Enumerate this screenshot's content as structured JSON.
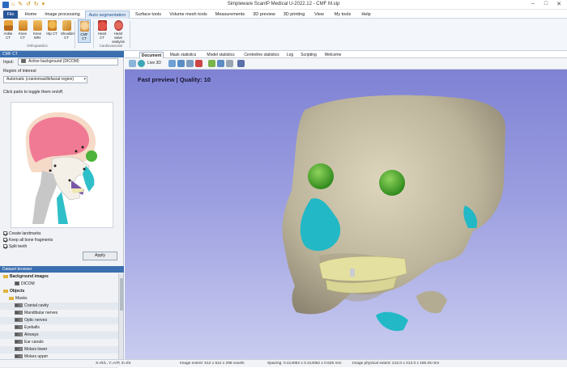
{
  "window": {
    "title": "Simpleware ScanIP Medical U-2022.12 - CMF M.sip",
    "quick_access": "⌂ ✎ ↺ ↻ ▾"
  },
  "menu": [
    "File",
    "Home",
    "Image processing",
    "Auto segmentation",
    "Surface tools",
    "Volume mesh tools",
    "Measurements",
    "3D preview",
    "3D printing",
    "View",
    "My tools",
    "Help"
  ],
  "ribbon": {
    "orthopaedics": {
      "buttons": [
        "Ankle CT",
        "Knee CT",
        "Knee MRI",
        "Hip CT",
        "Shoulder CT"
      ],
      "label": "Orthopaedics"
    },
    "cmf": {
      "buttons": [
        "CMF CT"
      ]
    },
    "cardiovascular": {
      "buttons": [
        "Heart CT",
        "Heart valve analysis"
      ],
      "label": "Cardiovascular"
    }
  },
  "left_panel": {
    "header": "CMF CT",
    "input_label": "Input:",
    "input_value": "Active background (DICOM)",
    "roi_label": "Region of interest",
    "roi_value": "Automatic (craniomaxillofacial region)",
    "toggle_hint": "Click parts to toggle them on/off.",
    "checkboxes": [
      "Create landmarks",
      "Keep all bone fragments",
      "Split teeth"
    ],
    "apply": "Apply"
  },
  "dataset_browser": {
    "header": "Dataset browser",
    "rows": [
      {
        "label": "Background images",
        "indent": 0,
        "kind": "folder"
      },
      {
        "label": "DICOM",
        "indent": 2,
        "kind": "dicom"
      },
      {
        "label": "Objects",
        "indent": 0,
        "kind": "folder"
      },
      {
        "label": "Masks",
        "indent": 1,
        "kind": "folder"
      },
      {
        "label": "Cranial cavity",
        "indent": 2,
        "kind": "mask"
      },
      {
        "label": "Mandibular nerves",
        "indent": 2,
        "kind": "mask"
      },
      {
        "label": "Optic nerves",
        "indent": 2,
        "kind": "mask"
      },
      {
        "label": "Eyeballs",
        "indent": 2,
        "kind": "mask"
      },
      {
        "label": "Airways",
        "indent": 2,
        "kind": "mask"
      },
      {
        "label": "Ear canals",
        "indent": 2,
        "kind": "mask"
      },
      {
        "label": "Molars lower",
        "indent": 2,
        "kind": "mask"
      },
      {
        "label": "Molars upper",
        "indent": 2,
        "kind": "mask"
      },
      {
        "label": "Incisors lower",
        "indent": 2,
        "kind": "mask"
      }
    ]
  },
  "view_tabs": [
    "Document",
    "Mask statistics",
    "Model statistics",
    "Centreline statistics",
    "Log",
    "Scripting",
    "Welcome"
  ],
  "toolbar": {
    "live3d": "Live 3D"
  },
  "viewport": {
    "preview_text": "Fast preview | Quality: 10"
  },
  "status": {
    "coords": "X=R/L, Y=A/P, Z=I/S",
    "extent": "Image extent: 512 x 512 x 298 voxels",
    "spacing": "Spacing: 0.414062 x 0.414062 x 0.625 mm",
    "physical": "Image physical extent: 212.0 x 212.0 x 186.25 mm"
  },
  "colors": {
    "accent": "#2b579a",
    "viewport_top": "#7f82d4",
    "bone": "#c9c2a8",
    "eyeball": "#56b23a",
    "airway": "#2bb7c2",
    "teeth": "#e6e1a0"
  }
}
